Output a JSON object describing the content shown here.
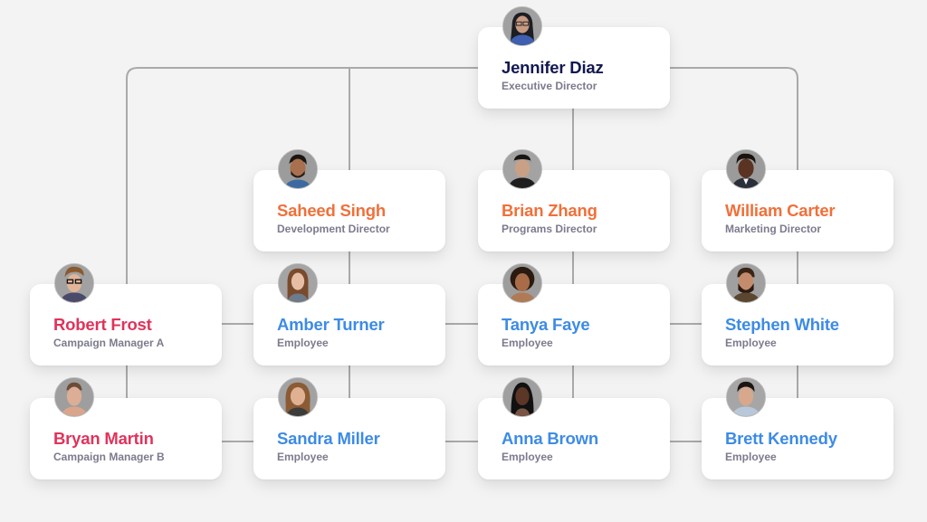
{
  "colors": {
    "executive": "#12184f",
    "director": "#f0703a",
    "manager": "#e0335b",
    "employee": "#3d8be6",
    "role_text": "#7b7b8e",
    "connector": "#a9a9a9",
    "background": "#f3f3f3"
  },
  "org_chart": {
    "executive": {
      "name": "Jennifer Diaz",
      "role": "Executive Director",
      "avatar": "person-photo"
    },
    "directors": [
      {
        "name": "Saheed Singh",
        "role": "Development Director",
        "avatar": "person-photo"
      },
      {
        "name": "Brian Zhang",
        "role": "Programs Director",
        "avatar": "person-photo"
      },
      {
        "name": "William Carter",
        "role": "Marketing Director",
        "avatar": "person-photo"
      }
    ],
    "managers": [
      {
        "name": "Robert Frost",
        "role": "Campaign Manager A",
        "avatar": "person-photo"
      },
      {
        "name": "Bryan Martin",
        "role": "Campaign Manager B",
        "avatar": "person-photo"
      }
    ],
    "employees_row1": [
      {
        "name": "Amber Turner",
        "role": "Employee",
        "avatar": "person-photo"
      },
      {
        "name": "Tanya Faye",
        "role": "Employee",
        "avatar": "person-photo"
      },
      {
        "name": "Stephen White",
        "role": "Employee",
        "avatar": "person-photo"
      }
    ],
    "employees_row2": [
      {
        "name": "Sandra Miller",
        "role": "Employee",
        "avatar": "person-photo"
      },
      {
        "name": "Anna Brown",
        "role": "Employee",
        "avatar": "person-photo"
      },
      {
        "name": "Brett Kennedy",
        "role": "Employee",
        "avatar": "person-photo"
      }
    ]
  }
}
